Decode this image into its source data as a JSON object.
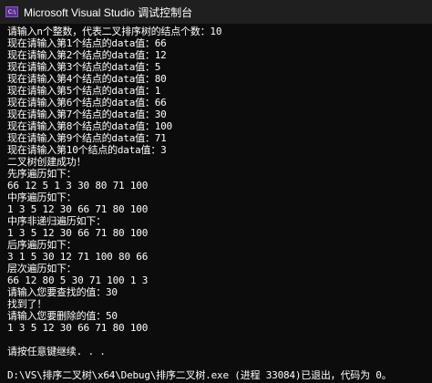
{
  "window": {
    "title": "Microsoft Visual Studio 调试控制台",
    "icon": "visual-studio-icon",
    "icon_text": "C:\\"
  },
  "console": {
    "lines": [
      "请输入n个整数，代表二叉排序树的结点个数：10",
      "现在请输入第1个结点的data值：66",
      "现在请输入第2个结点的data值：12",
      "现在请输入第3个结点的data值：5",
      "现在请输入第4个结点的data值：80",
      "现在请输入第5个结点的data值：1",
      "现在请输入第6个结点的data值：66",
      "现在请输入第7个结点的data值：30",
      "现在请输入第8个结点的data值：100",
      "现在请输入第9个结点的data值：71",
      "现在请输入第10个结点的data值：3",
      "二叉树创建成功！",
      "先序遍历如下：",
      "66 12 5 1 3 30 80 71 100",
      "中序遍历如下：",
      "1 3 5 12 30 66 71 80 100",
      "中序非递归遍历如下：",
      "1 3 5 12 30 66 71 80 100",
      "后序遍历如下：",
      "3 1 5 30 12 71 100 80 66",
      "层次遍历如下：",
      "66 12 80 5 30 71 100 1 3",
      "请输入您要查找的值：30",
      "找到了！",
      "请输入您要删除的值：50",
      "1 3 5 12 30 66 71 80 100",
      "",
      "请按任意键继续. . .",
      "",
      "D:\\VS\\排序二叉树\\x64\\Debug\\排序二叉树.exe (进程 33084)已退出，代码为 0。"
    ]
  }
}
